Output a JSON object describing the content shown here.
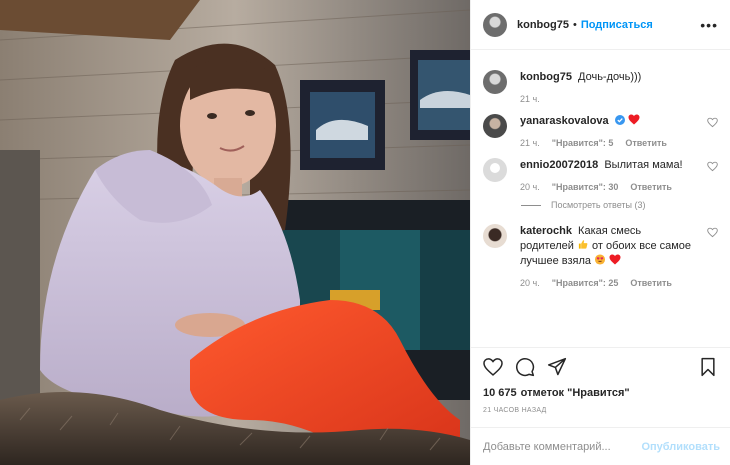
{
  "header": {
    "username": "konbog75",
    "separator": "•",
    "follow_label": "Подписаться",
    "more_icon": "ellipsis-icon"
  },
  "caption": {
    "username": "konbog75",
    "text": "Дочь-дочь)))",
    "time": "21 ч."
  },
  "comments": [
    {
      "username": "yanaraskovalova",
      "text": "",
      "verified": true,
      "emoji": "red-heart",
      "time": "21 ч.",
      "likes": "\"Нравится\": 5",
      "reply": "Ответить"
    },
    {
      "username": "ennio20072018",
      "text": "Вылитая мама!",
      "time": "20 ч.",
      "likes": "\"Нравится\": 30",
      "reply": "Ответить",
      "replies_label": "Посмотреть ответы (3)"
    },
    {
      "username": "katerochk",
      "text_part1": "Какая смесь родителей",
      "text_part2": "от обоих все самое лучшее взяла",
      "time": "20 ч.",
      "likes": "\"Нравится\": 25",
      "reply": "Ответить"
    }
  ],
  "actions": {
    "icons": [
      "heart-icon",
      "comment-icon",
      "share-icon",
      "bookmark-icon"
    ],
    "likes_count": "10 675",
    "likes_label": "отметок \"Нравится\"",
    "time_ago": "21 часов назад"
  },
  "add_comment": {
    "placeholder": "Добавьте комментарий...",
    "publish_label": "Опубликовать"
  },
  "colors": {
    "accent": "#0095f6",
    "publish_disabled": "#b2dffc",
    "muted": "#8e8e8e",
    "heart_red": "#ed4956"
  }
}
